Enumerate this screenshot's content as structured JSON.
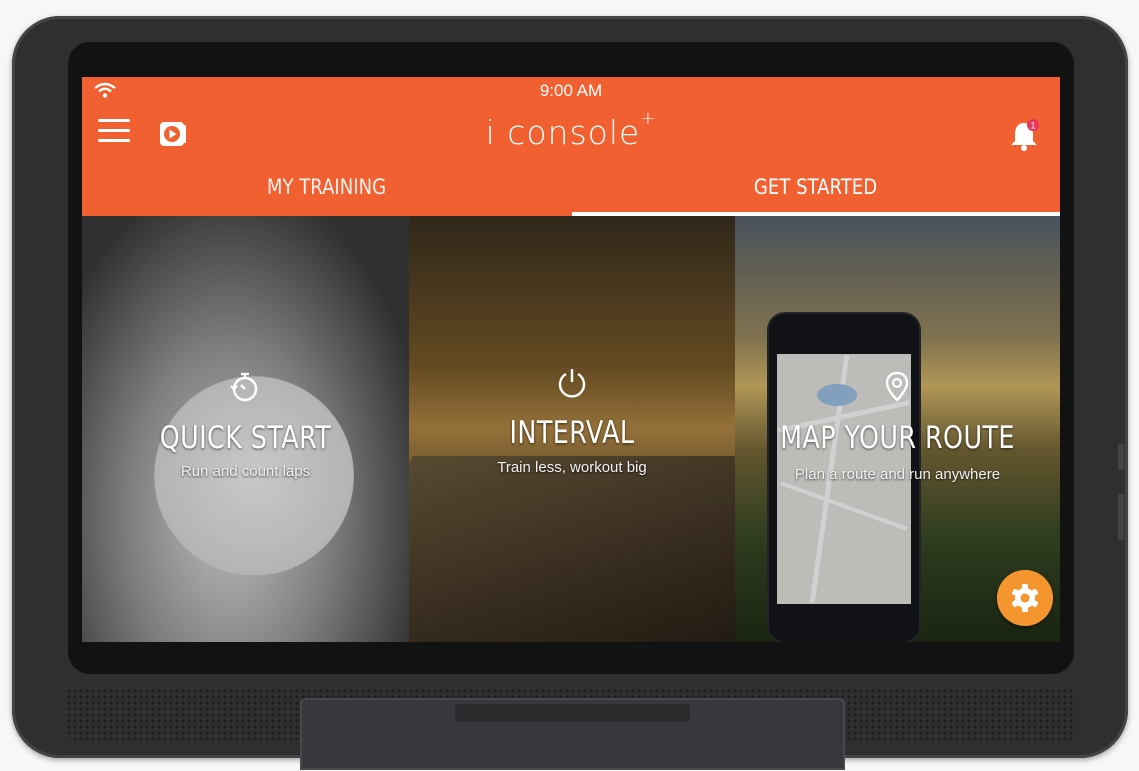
{
  "status_bar": {
    "time": "9:00 AM",
    "wifi_icon": "wifi-icon"
  },
  "header": {
    "logo_main": "i console",
    "logo_sup": "+",
    "menu_icon": "hamburger-menu-icon",
    "video_icon": "play-video-icon",
    "notification_icon": "bell-icon",
    "notification_badge": "1",
    "accent_color": "#f06030"
  },
  "tabs": [
    {
      "label": "MY TRAINING",
      "selected": false
    },
    {
      "label": "GET STARTED",
      "selected": true
    }
  ],
  "tiles": [
    {
      "icon": "stopwatch-icon",
      "title": "QUICK START",
      "subtitle": "Run and count laps"
    },
    {
      "icon": "power-icon",
      "title": "INTERVAL",
      "subtitle": "Train less, workout big"
    },
    {
      "icon": "location-pin-icon",
      "title": "MAP YOUR ROUTE",
      "subtitle": "Plan a route and run anywhere"
    }
  ],
  "fab": {
    "icon": "gear-icon",
    "color": "#f4952e"
  }
}
